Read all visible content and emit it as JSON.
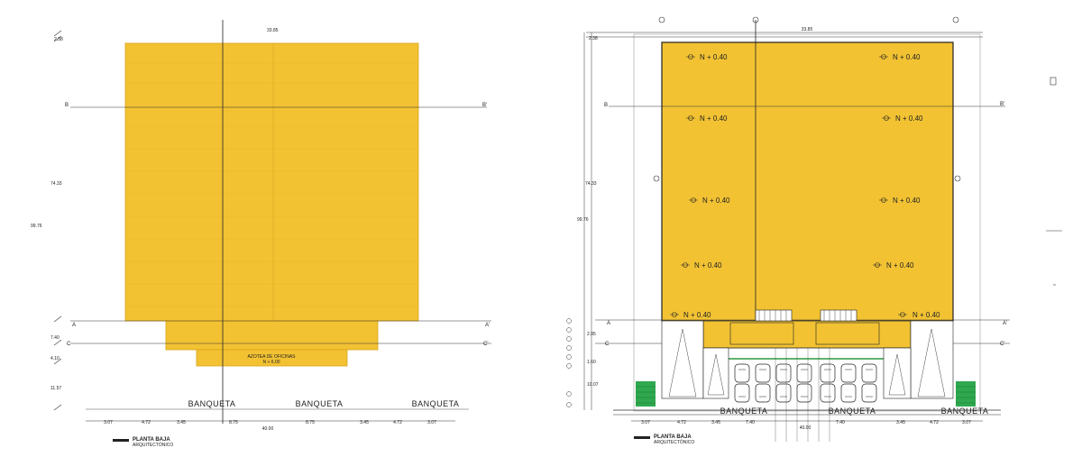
{
  "colors": {
    "roof": "#f2c233",
    "roof_dark": "#e4ad1c",
    "line": "#222222",
    "grass": "#2fa84f",
    "accent": "#2b9a3e"
  },
  "left_plan": {
    "top_width": "33.85",
    "top_offset": "2.38",
    "dim_main": "74.33",
    "dim_total": "99.76",
    "dim_a": "7.40",
    "dim_b": "4.10",
    "dim_c": "11.57",
    "axis_b_left": "B",
    "axis_b_right": "B'",
    "axis_a_left": "A",
    "axis_a_right": "A'",
    "axis_c_left": "C",
    "axis_c_right": "C'",
    "office_label": "AZOTEA DE OFICINAS",
    "office_level": "N + 6.00",
    "sidewalk": [
      "BANQUETA",
      "BANQUETA",
      "BANQUETA"
    ],
    "bottom_dims": [
      "3.07",
      "4.72",
      "3.45",
      "8.75",
      "8.75",
      "3.45",
      "4.72",
      "3.07"
    ],
    "bottom_total": "40.00",
    "title": "PLANTA BAJA",
    "subtitle": "ARQUITECTÓNICO"
  },
  "right_plan": {
    "top_width": "33.85",
    "top_offset": "2.38",
    "dim_main": "74.33",
    "dim_total": "99.76",
    "dim_bottom": "10.07",
    "dim_small": "2.95",
    "dim_small2": "1.60",
    "axis_b_left": "B",
    "axis_b_right": "B'",
    "axis_a_left": "A",
    "axis_a_right": "A'",
    "axis_c_left": "C",
    "axis_c_right": "C'",
    "levels": [
      "N + 0.40",
      "N + 0.40",
      "N + 0.40",
      "N + 0.40",
      "N + 0.40",
      "N + 0.40",
      "N + 0.40",
      "N + 0.40",
      "N + 0.40",
      "N + 0.40"
    ],
    "sidewalk": [
      "BANQUETA",
      "BANQUETA",
      "BANQUETA"
    ],
    "bottom_dims": [
      "3.07",
      "4.72",
      "3.45",
      "7.40",
      "7.40",
      "3.45",
      "4.72",
      "3.07"
    ],
    "bottom_total": "40.00",
    "title": "PLANTA BAJA",
    "subtitle": "ARQUITECTÓNICO"
  }
}
